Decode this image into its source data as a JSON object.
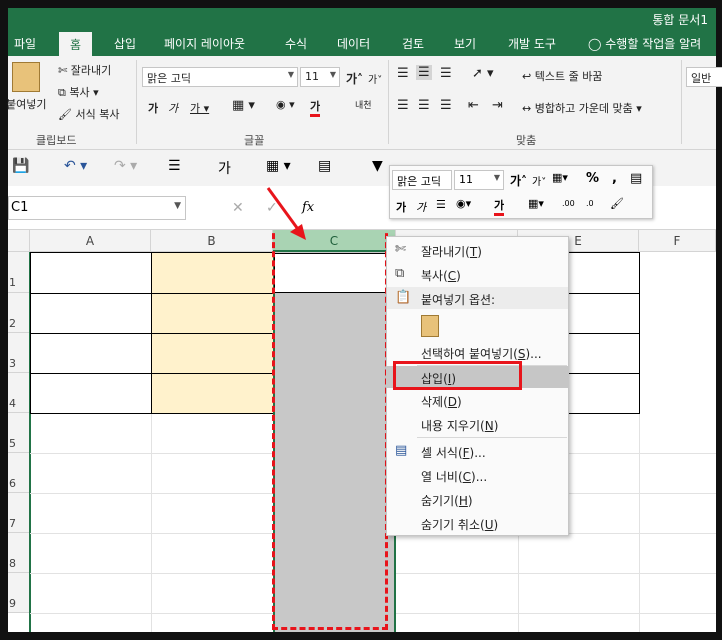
{
  "app": {
    "window_title": "통합 문서1"
  },
  "tabs": [
    {
      "label": "파일"
    },
    {
      "label": "홈"
    },
    {
      "label": "삽입"
    },
    {
      "label": "페이지 레이아웃"
    },
    {
      "label": "수식"
    },
    {
      "label": "데이터"
    },
    {
      "label": "검토"
    },
    {
      "label": "보기"
    },
    {
      "label": "개발 도구"
    }
  ],
  "tellme": {
    "placeholder": "수행할 작업을 알려"
  },
  "ribbon": {
    "clipboard": {
      "paste_label": "붙여넣기",
      "cut_label": "잘라내기",
      "copy_label": "복사",
      "format_painter_label": "서식 복사",
      "group_label": "클립보드"
    },
    "font": {
      "font_name": "맑은 고딕",
      "font_size": "11",
      "group_label": "글꼴"
    },
    "alignment": {
      "wrap_text_label": "텍스트 줄 바꿈",
      "merge_label": "병합하고 가운데 맞춤",
      "group_label": "맞춤"
    },
    "number": {
      "format_value": "일반"
    }
  },
  "namebox": {
    "value": "C1"
  },
  "columns": [
    "A",
    "B",
    "C",
    "D",
    "E",
    "F"
  ],
  "rows": [
    "1",
    "2",
    "3",
    "4",
    "5",
    "6",
    "7",
    "8",
    "9"
  ],
  "minibar": {
    "font_name": "맑은 고딕",
    "font_size": "11"
  },
  "context_menu": {
    "cut": {
      "label": "잘라내기",
      "key": "T"
    },
    "copy": {
      "label": "복사",
      "key": "C"
    },
    "paste_options_header": "붙여넣기 옵션:",
    "paste_special": {
      "label": "선택하여 붙여넣기",
      "key": "S",
      "suffix": "..."
    },
    "insert": {
      "label": "삽입",
      "key": "I"
    },
    "delete": {
      "label": "삭제",
      "key": "D"
    },
    "clear": {
      "label": "내용 지우기",
      "key": "N"
    },
    "format_cells": {
      "label": "셀 서식",
      "key": "F",
      "suffix": "..."
    },
    "col_width": {
      "label": "열 너비",
      "key": "C",
      "suffix": "..."
    },
    "hide": {
      "label": "숨기기",
      "key": "H"
    },
    "unhide": {
      "label": "숨기기 취소",
      "key": "U"
    }
  },
  "colors": {
    "excel_green": "#217346",
    "highlight_red": "#e8141b",
    "b_fill": "#fff2cc",
    "c_fill": "#c8c8c8"
  }
}
